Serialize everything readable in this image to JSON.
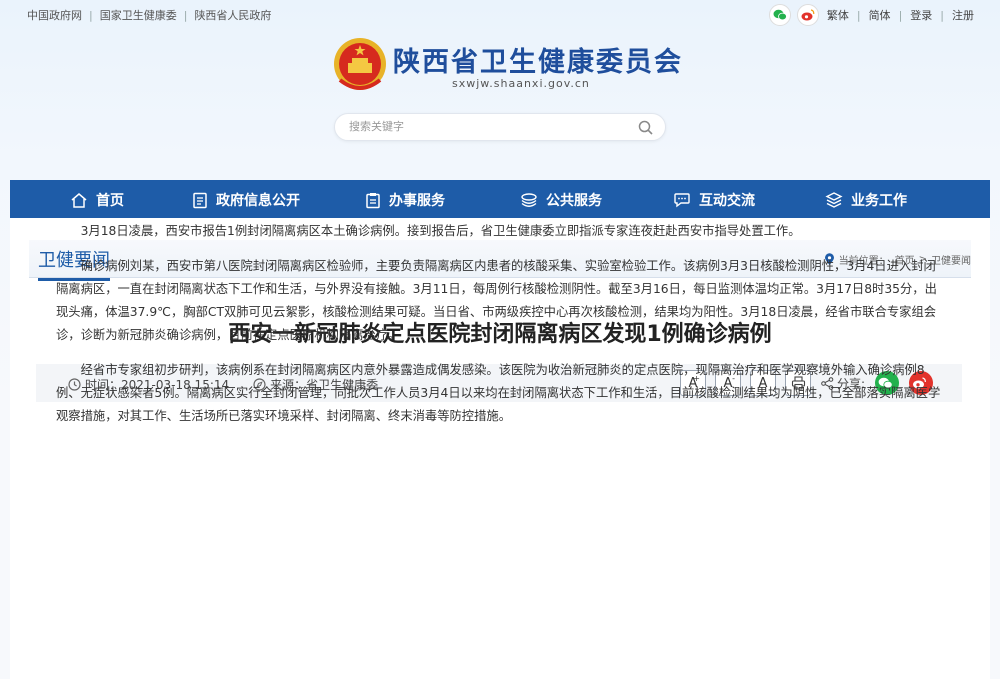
{
  "topbar": {
    "links": [
      "中国政府网",
      "国家卫生健康委",
      "陕西省人民政府"
    ],
    "right": [
      "繁体",
      "简体",
      "登录",
      "注册"
    ]
  },
  "header": {
    "title": "陕西省卫生健康委员会",
    "domain": "sxwjw.shaanxi.gov.cn",
    "search_placeholder": "搜索关键字"
  },
  "nav": {
    "items": [
      {
        "label": "首页",
        "icon": "home-icon"
      },
      {
        "label": "政府信息公开",
        "icon": "document-icon"
      },
      {
        "label": "办事服务",
        "icon": "clipboard-icon"
      },
      {
        "label": "公共服务",
        "icon": "layers-icon"
      },
      {
        "label": "互动交流",
        "icon": "chat-icon"
      },
      {
        "label": "业务工作",
        "icon": "stack-icon"
      }
    ]
  },
  "section": {
    "title": "卫健要闻",
    "breadcrumb_prefix": "当前位置：",
    "breadcrumb": [
      "首页",
      "卫健要闻"
    ],
    "breadcrumb_sep": ">"
  },
  "article": {
    "title": "西安一新冠肺炎定点医院封闭隔离病区发现1例确诊病例",
    "time_label": "时间：2021-03-18 15:14",
    "source_label": "来源：省卫生健康委",
    "font_large": "A",
    "font_small": "A",
    "font_reset": "A",
    "share_label": "分享:",
    "paragraphs": [
      "3月18日凌晨，西安市报告1例封闭隔离病区本土确诊病例。接到报告后，省卫生健康委立即指派专家连夜赶赴西安市指导处置工作。",
      "确诊病例刘某，西安市第八医院封闭隔离病区检验师，主要负责隔离病区内患者的核酸采集、实验室检验工作。该病例3月3日核酸检测阴性，3月4日进入封闭隔离病区，一直在封闭隔离状态下工作和生活，与外界没有接触。3月11日，每周例行核酸检测阴性。截至3月16日，每日监测体温均正常。3月17日8时35分，出现头痛，体温37.9℃，胸部CT双肺可见云絮影，核酸检测结果可疑。当日省、市两级疾控中心再次核酸检测，结果均为阳性。3月18日凌晨，经省市联合专家组会诊，诊断为新冠肺炎确诊病例，目前在定点医疗机构隔离治疗。",
      "经省市专家组初步研判，该病例系在封闭隔离病区内意外暴露造成偶发感染。该医院为收治新冠肺炎的定点医院，现隔离治疗和医学观察境外输入确诊病例8例、无症状感染者5例。隔离病区实行全封闭管理，同批次工作人员3月4日以来均在封闭隔离状态下工作和生活，目前核酸检测结果均为阴性，已全部落实隔离医学观察措施，对其工作、生活场所已落实环境采样、封闭隔离、终末消毒等防控措施。"
    ]
  },
  "colors": {
    "nav_bg": "#1e5ca8",
    "title_blue": "#1f4e9c",
    "wechat_green": "#23b14d",
    "weibo_red": "#e2322b"
  }
}
